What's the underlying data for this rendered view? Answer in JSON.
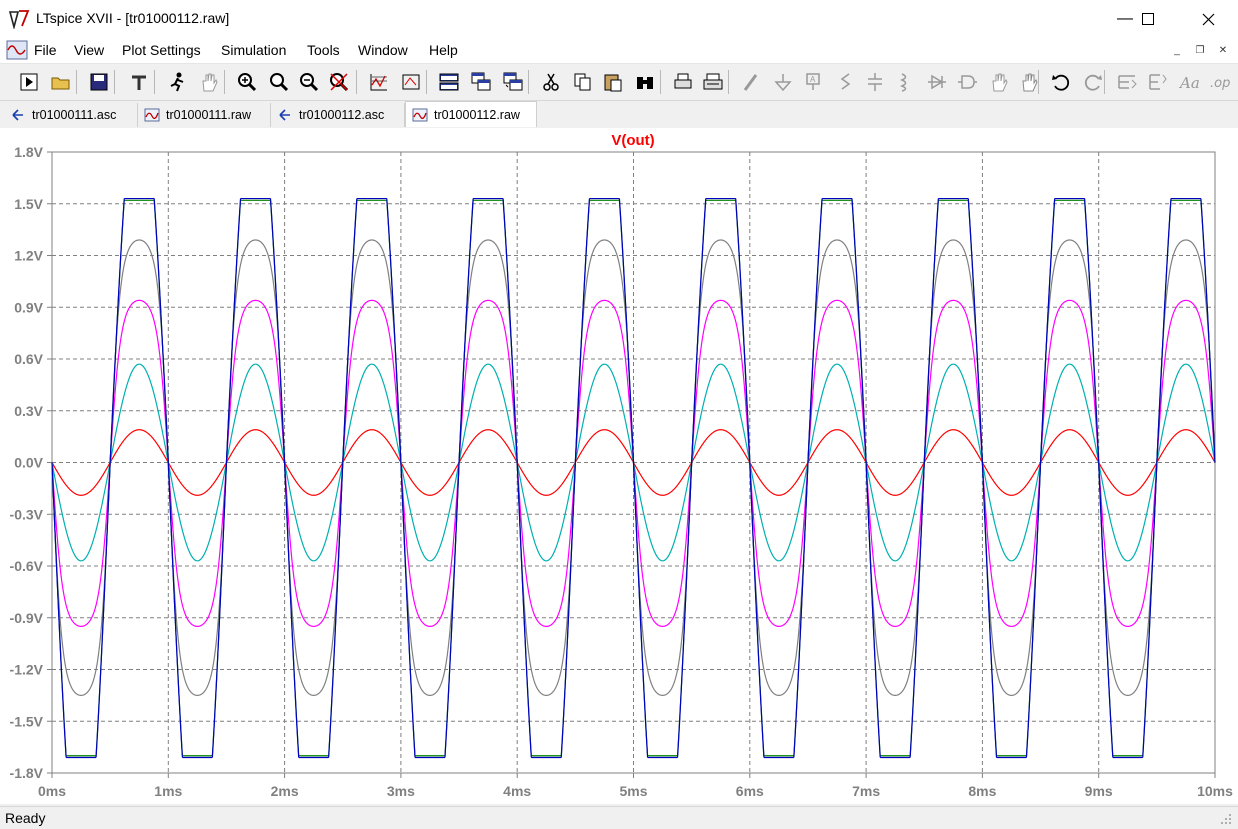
{
  "window": {
    "title": "LTspice XVII - [tr01000112.raw]"
  },
  "menu": {
    "items": [
      "File",
      "View",
      "Plot Settings",
      "Simulation",
      "Tools",
      "Window",
      "Help"
    ]
  },
  "toolbar": {
    "buttons": [
      "run-icon",
      "open-icon",
      "save-icon",
      "control-panel-icon",
      "halt-icon",
      "pan-hand-icon",
      "zoom-in-icon",
      "zoom-area-icon",
      "zoom-out-icon",
      "zoom-cancel-icon",
      "autorange-icon",
      "zoom-fit-icon",
      "tile-horizontal-icon",
      "cascade-icon",
      "tile-vertical-icon",
      "cut-icon",
      "copy-icon",
      "paste-icon",
      "find-icon",
      "print-preview-icon",
      "print-icon",
      "wire-icon",
      "ground-icon",
      "label-icon",
      "resistor-icon",
      "capacitor-icon",
      "inductor-icon",
      "diode-icon",
      "component-icon",
      "move-icon",
      "drag-icon",
      "undo-icon",
      "redo-icon",
      "rotate-icon",
      "mirror-icon",
      "text-icon",
      "spice-directive-icon"
    ]
  },
  "tabs": [
    {
      "label": "tr01000111.asc",
      "icon": "schematic-icon",
      "active": false
    },
    {
      "label": "tr01000111.raw",
      "icon": "waveform-icon",
      "active": false
    },
    {
      "label": "tr01000112.asc",
      "icon": "schematic-icon",
      "active": false
    },
    {
      "label": "tr01000112.raw",
      "icon": "waveform-icon",
      "active": true
    }
  ],
  "status": {
    "text": "Ready"
  },
  "chart_data": {
    "type": "line",
    "title": "V(out)",
    "title_color": "#ff0000",
    "xlabel": "",
    "ylabel": "",
    "xlim": [
      0,
      10
    ],
    "ylim": [
      -1.8,
      1.8
    ],
    "x_ticks": [
      "0ms",
      "1ms",
      "2ms",
      "3ms",
      "4ms",
      "5ms",
      "6ms",
      "7ms",
      "8ms",
      "9ms",
      "10ms"
    ],
    "y_ticks": [
      "1.8V",
      "1.5V",
      "1.2V",
      "0.9V",
      "0.6V",
      "0.3V",
      "0.0V",
      "-0.3V",
      "-0.6V",
      "-0.9V",
      "-1.2V",
      "-1.5V",
      "-1.8V"
    ],
    "grid": true,
    "signal": {
      "waveform": "sine",
      "frequency_khz": 1.0,
      "phase": "inverted",
      "x_unit": "ms"
    },
    "series": [
      {
        "color": "#ff0000",
        "peak_pos": 0.19,
        "peak_neg": -0.19
      },
      {
        "color": "#00b0b0",
        "peak_pos": 0.57,
        "peak_neg": -0.57
      },
      {
        "color": "#ff00ff",
        "peak_pos": 0.94,
        "peak_neg": -0.95
      },
      {
        "color": "#808080",
        "peak_pos": 1.29,
        "peak_neg": -1.35
      },
      {
        "color": "#008000",
        "peak_pos": 1.52,
        "peak_neg": -1.7
      },
      {
        "color": "#0000c0",
        "peak_pos": 1.53,
        "peak_neg": -1.71
      }
    ]
  }
}
